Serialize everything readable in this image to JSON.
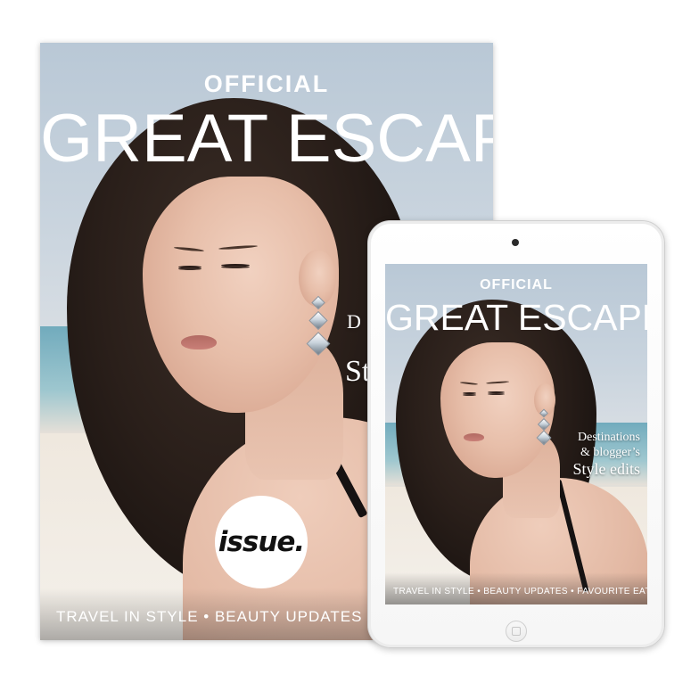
{
  "magazine": {
    "kicker": "OFFICIAL",
    "title": "GREAT ESCAPE",
    "cropped_tagline_1": "D",
    "cropped_tagline_2": "St",
    "footer": "TRAVEL IN STYLE • BEAUTY UPDATES • FA",
    "logo": "issue."
  },
  "tablet": {
    "kicker": "OFFICIAL",
    "title": "GREAT ESCAPE",
    "tagline_line1": "Destinations",
    "tagline_line2": "& blogger’s",
    "tagline_line3": "Style edits",
    "footer": "TRAVEL IN STYLE • BEAUTY UPDATES • FAVOURITE EATS"
  },
  "colors": {
    "background": "#ffffff",
    "cover_text": "#ffffff",
    "logo_disc": "#ffffff",
    "logo_text": "#111111"
  }
}
